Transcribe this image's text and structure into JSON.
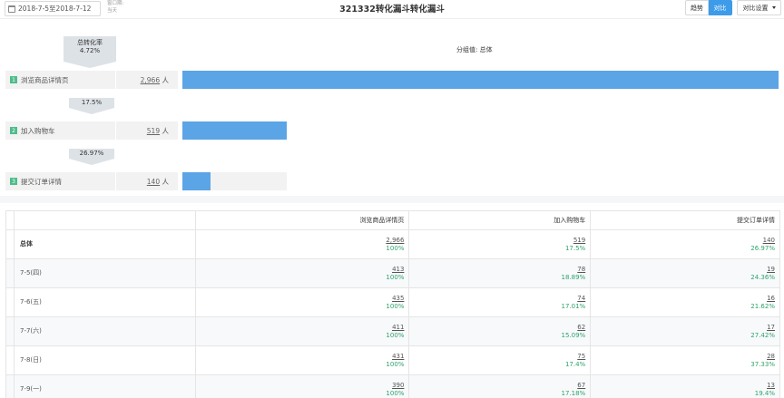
{
  "header": {
    "date_range": "2018-7-5至2018-7-12",
    "window_label_1": "窗口期:",
    "window_label_2": "当天",
    "title": "321332转化漏斗转化漏斗",
    "trend_label": "趋势",
    "compare_label": "对比",
    "compare_setting_label": "对比设置"
  },
  "funnel": {
    "overall_label": "总转化率",
    "overall_value": "4.72%",
    "segment_label": "分组值: 总体",
    "steps": [
      {
        "num": "1",
        "name": "浏览商品详情页",
        "count": "2,966",
        "unit": "人",
        "ratio": 1.0
      },
      {
        "num": "2",
        "name": "加入购物车",
        "count": "519",
        "unit": "人",
        "ratio": 0.175
      },
      {
        "num": "3",
        "name": "提交订单详情",
        "count": "140",
        "unit": "人",
        "ratio": 0.0472
      }
    ],
    "conversions": [
      "17.5%",
      "26.97%"
    ]
  },
  "table": {
    "headers": [
      "浏览商品详情页",
      "加入购物车",
      "提交订单详情"
    ],
    "rows": [
      {
        "label": "总体",
        "total": true,
        "cells": [
          [
            "2,966",
            "100%"
          ],
          [
            "519",
            "17.5%"
          ],
          [
            "140",
            "26.97%"
          ]
        ]
      },
      {
        "label": "7-5(四)",
        "cells": [
          [
            "413",
            "100%"
          ],
          [
            "78",
            "18.89%"
          ],
          [
            "19",
            "24.36%"
          ]
        ]
      },
      {
        "label": "7-6(五)",
        "cells": [
          [
            "435",
            "100%"
          ],
          [
            "74",
            "17.01%"
          ],
          [
            "16",
            "21.62%"
          ]
        ]
      },
      {
        "label": "7-7(六)",
        "cells": [
          [
            "411",
            "100%"
          ],
          [
            "62",
            "15.09%"
          ],
          [
            "17",
            "27.42%"
          ]
        ]
      },
      {
        "label": "7-8(日)",
        "cells": [
          [
            "431",
            "100%"
          ],
          [
            "75",
            "17.4%"
          ],
          [
            "28",
            "37.33%"
          ]
        ]
      },
      {
        "label": "7-9(一)",
        "cells": [
          [
            "390",
            "100%"
          ],
          [
            "67",
            "17.18%"
          ],
          [
            "13",
            "19.4%"
          ]
        ]
      }
    ]
  },
  "colors": {
    "accent": "#3d9bea",
    "bar": "#5ba4e6",
    "step_num": "#4ebc8a",
    "percent": "#2ea36b"
  }
}
